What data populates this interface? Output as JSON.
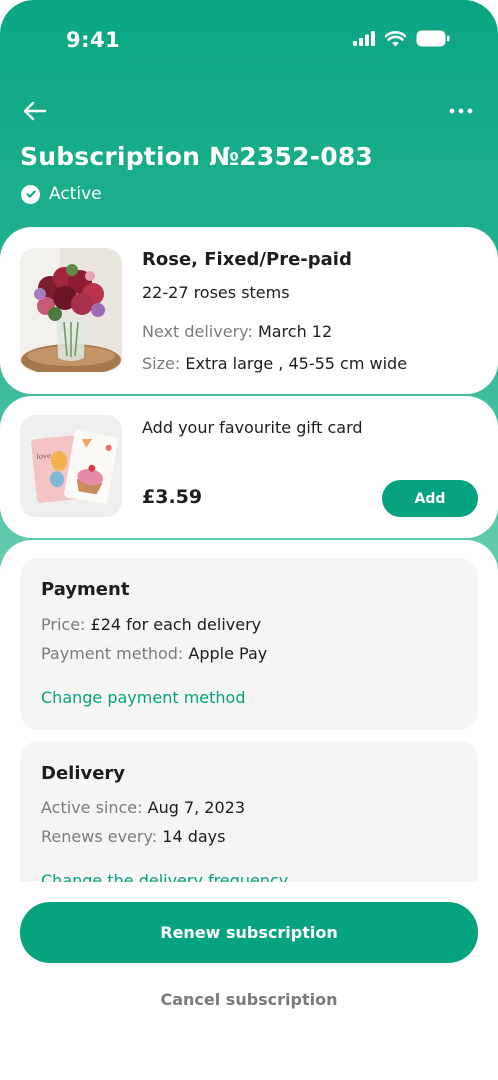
{
  "status_bar": {
    "time": "9:41"
  },
  "header": {
    "title": "Subscription №2352-083",
    "status": "Active"
  },
  "product": {
    "name": "Rose, Fixed/Pre-paid",
    "stems": "22-27 roses stems",
    "next_delivery_label": "Next delivery:",
    "next_delivery_value": "March 12",
    "size_label": "Size:",
    "size_value": "Extra large , 45-55 cm wide"
  },
  "gift": {
    "text": "Add your favourite gift card",
    "price": "£3.59",
    "add_label": "Add"
  },
  "payment": {
    "title": "Payment",
    "price_label": "Price:",
    "price_value": "£24 for each delivery",
    "method_label": "Payment method:",
    "method_value": "Apple Pay",
    "change_link": "Change payment method"
  },
  "delivery": {
    "title": "Delivery",
    "since_label": "Active since:",
    "since_value": "Aug 7, 2023",
    "renews_label": "Renews every:",
    "renews_value": "14 days",
    "change_link": "Change the delivery frequency"
  },
  "actions": {
    "renew_label": "Renew subscription",
    "cancel_label": "Cancel subscription"
  },
  "colors": {
    "brand_green": "#06a27f",
    "muted_text": "#7b7b7b",
    "panel_bg": "#f5f5f5"
  }
}
